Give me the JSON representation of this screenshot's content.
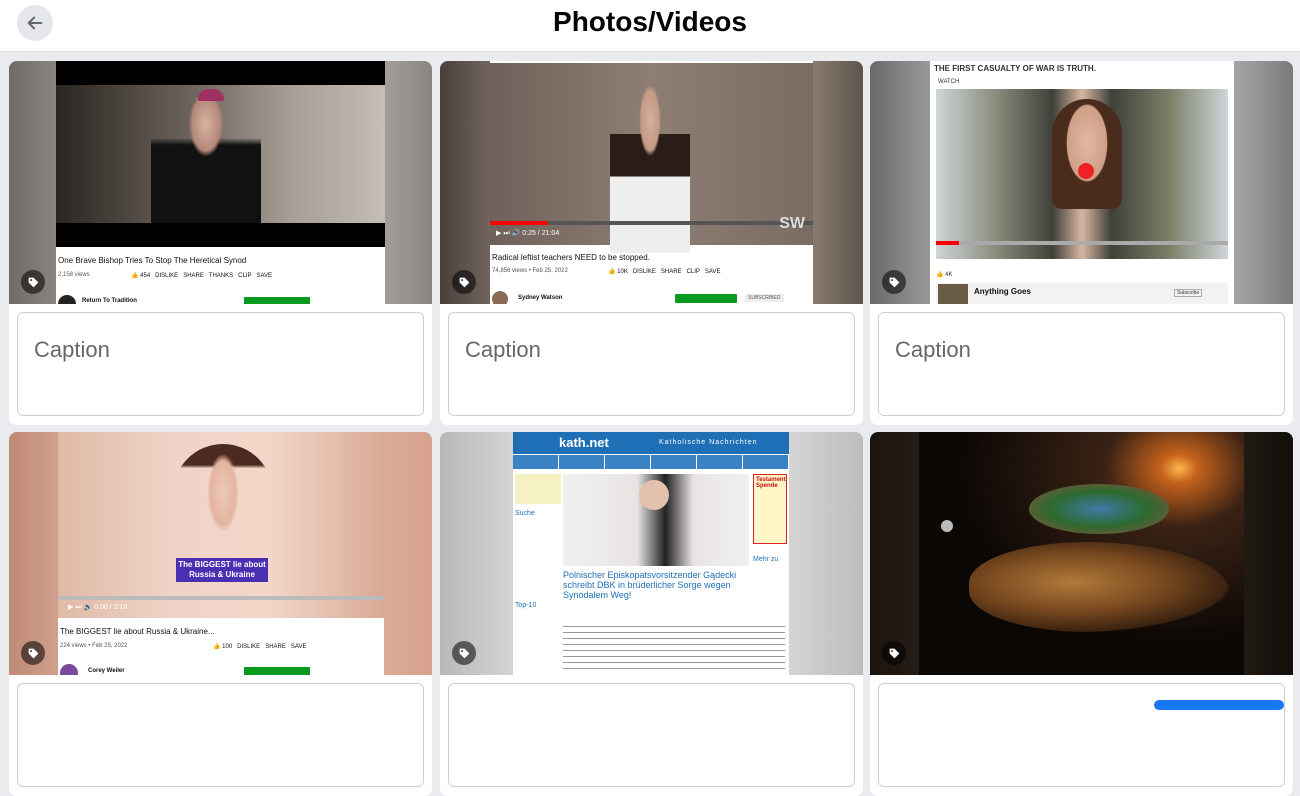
{
  "header": {
    "title": "Photos/Videos"
  },
  "caption_placeholder": "Caption",
  "cards": [
    {
      "title": "One Brave Bishop Tries To Stop The Heretical Synod",
      "meta": "2,158 views",
      "likes": "454",
      "dislike": "DISLIKE",
      "share": "SHARE",
      "thanks": "THANKS",
      "clip": "CLIP",
      "save": "SAVE",
      "channel": "Return To Tradition"
    },
    {
      "title": "Radical leftist teachers NEED to be stopped.",
      "meta": "74,856 views • Feb 25, 2022",
      "likes": "10K",
      "dislike": "DISLIKE",
      "share": "SHARE",
      "clip": "CLIP",
      "save": "SAVE",
      "channel": "Sydney Watson",
      "time": "0:25 / 21:04",
      "watermark": "SW",
      "subscribed": "SUBSCRIBED"
    },
    {
      "headline": "THE FIRST CASUALTY OF WAR IS TRUTH.",
      "watch": "WATCH",
      "channel": "Anything Goes",
      "subscribe": "Subscribe",
      "likes": "4K"
    },
    {
      "overlay": "The BIGGEST lie about Russia & Ukraine",
      "title": "The BIGGEST lie about Russia & Ukraine...",
      "meta": "224 views • Feb 25, 2022",
      "likes": "100",
      "dislike": "DISLIKE",
      "share": "SHARE",
      "save": "SAVE",
      "channel": "Corey Weiler",
      "time": "0:00 / 2:16"
    },
    {
      "site": "kath.net",
      "site_sub": "Katholische Nachrichten",
      "headline": "Polnischer Episkopatsvorsitzender Gądecki schreibt DBK in brüderlicher Sorge wegen Synodalem Weg!",
      "sidebar_search": "Suche",
      "sidebar_top": "Top-10",
      "testament": "Testament Spende",
      "mehr": "Mehr zu"
    },
    {}
  ],
  "colors": {
    "accent": "#1877f2",
    "card_bg": "#ffffff",
    "page_bg": "#e9ebee",
    "yt_red": "#ff0000"
  }
}
